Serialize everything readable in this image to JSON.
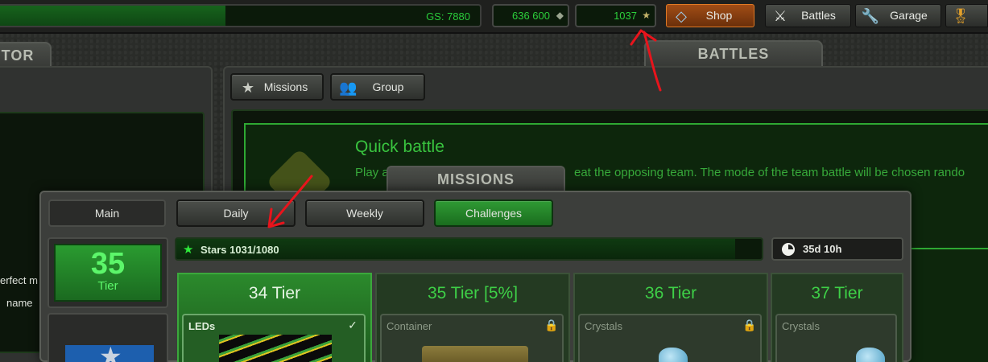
{
  "topbar": {
    "gs": {
      "label": "GS: 7880",
      "progress": 0.47
    },
    "crystals": {
      "value": "636 600",
      "icon": "crystal-icon"
    },
    "stars": {
      "value": "1037",
      "icon": "star-icon"
    },
    "buttons": [
      {
        "label": "Shop",
        "icon": "diamond-icon"
      },
      {
        "label": "Battles",
        "icon": "crossed-swords-icon"
      },
      {
        "label": "Garage",
        "icon": "wrench-icon"
      }
    ]
  },
  "left_header": "TOR",
  "left_panel_fragments": [
    "erfect m",
    "name"
  ],
  "battles_header": "BATTLES",
  "battles_tabs": [
    {
      "label": "Missions",
      "icon": "star-icon"
    },
    {
      "label": "Group",
      "icon": "group-icon"
    }
  ],
  "quick_battle": {
    "title": "Quick battle",
    "desc_start": "Play a",
    "desc_end": "eat the opposing team. The mode of the team battle will be chosen rando"
  },
  "missions": {
    "title": "MISSIONS",
    "main_label": "Main",
    "tabs": [
      "Daily",
      "Weekly",
      "Challenges"
    ],
    "active_tab": "Challenges",
    "current_tier": {
      "number": "35",
      "label": "Tier"
    },
    "stars_label": "Stars 1031/1080",
    "stars_progress": 0.955,
    "timer": "35d 10h",
    "tiers": [
      {
        "title": "34 Tier",
        "item": "LEDs",
        "status": "claimed",
        "status_icon": "checkmark-icon"
      },
      {
        "title": "35 Tier [5%]",
        "item": "Container",
        "status": "locked",
        "status_icon": "lock-icon"
      },
      {
        "title": "36 Tier",
        "item": "Crystals",
        "status": "locked",
        "status_icon": "lock-icon"
      },
      {
        "title": "37 Tier",
        "item": "Crystals",
        "status": "locked",
        "status_icon": "lock-icon"
      }
    ]
  },
  "colors": {
    "accent_green": "#2ccf3b",
    "shop_orange": "#e07a25",
    "annotation_red": "#e8141c"
  }
}
